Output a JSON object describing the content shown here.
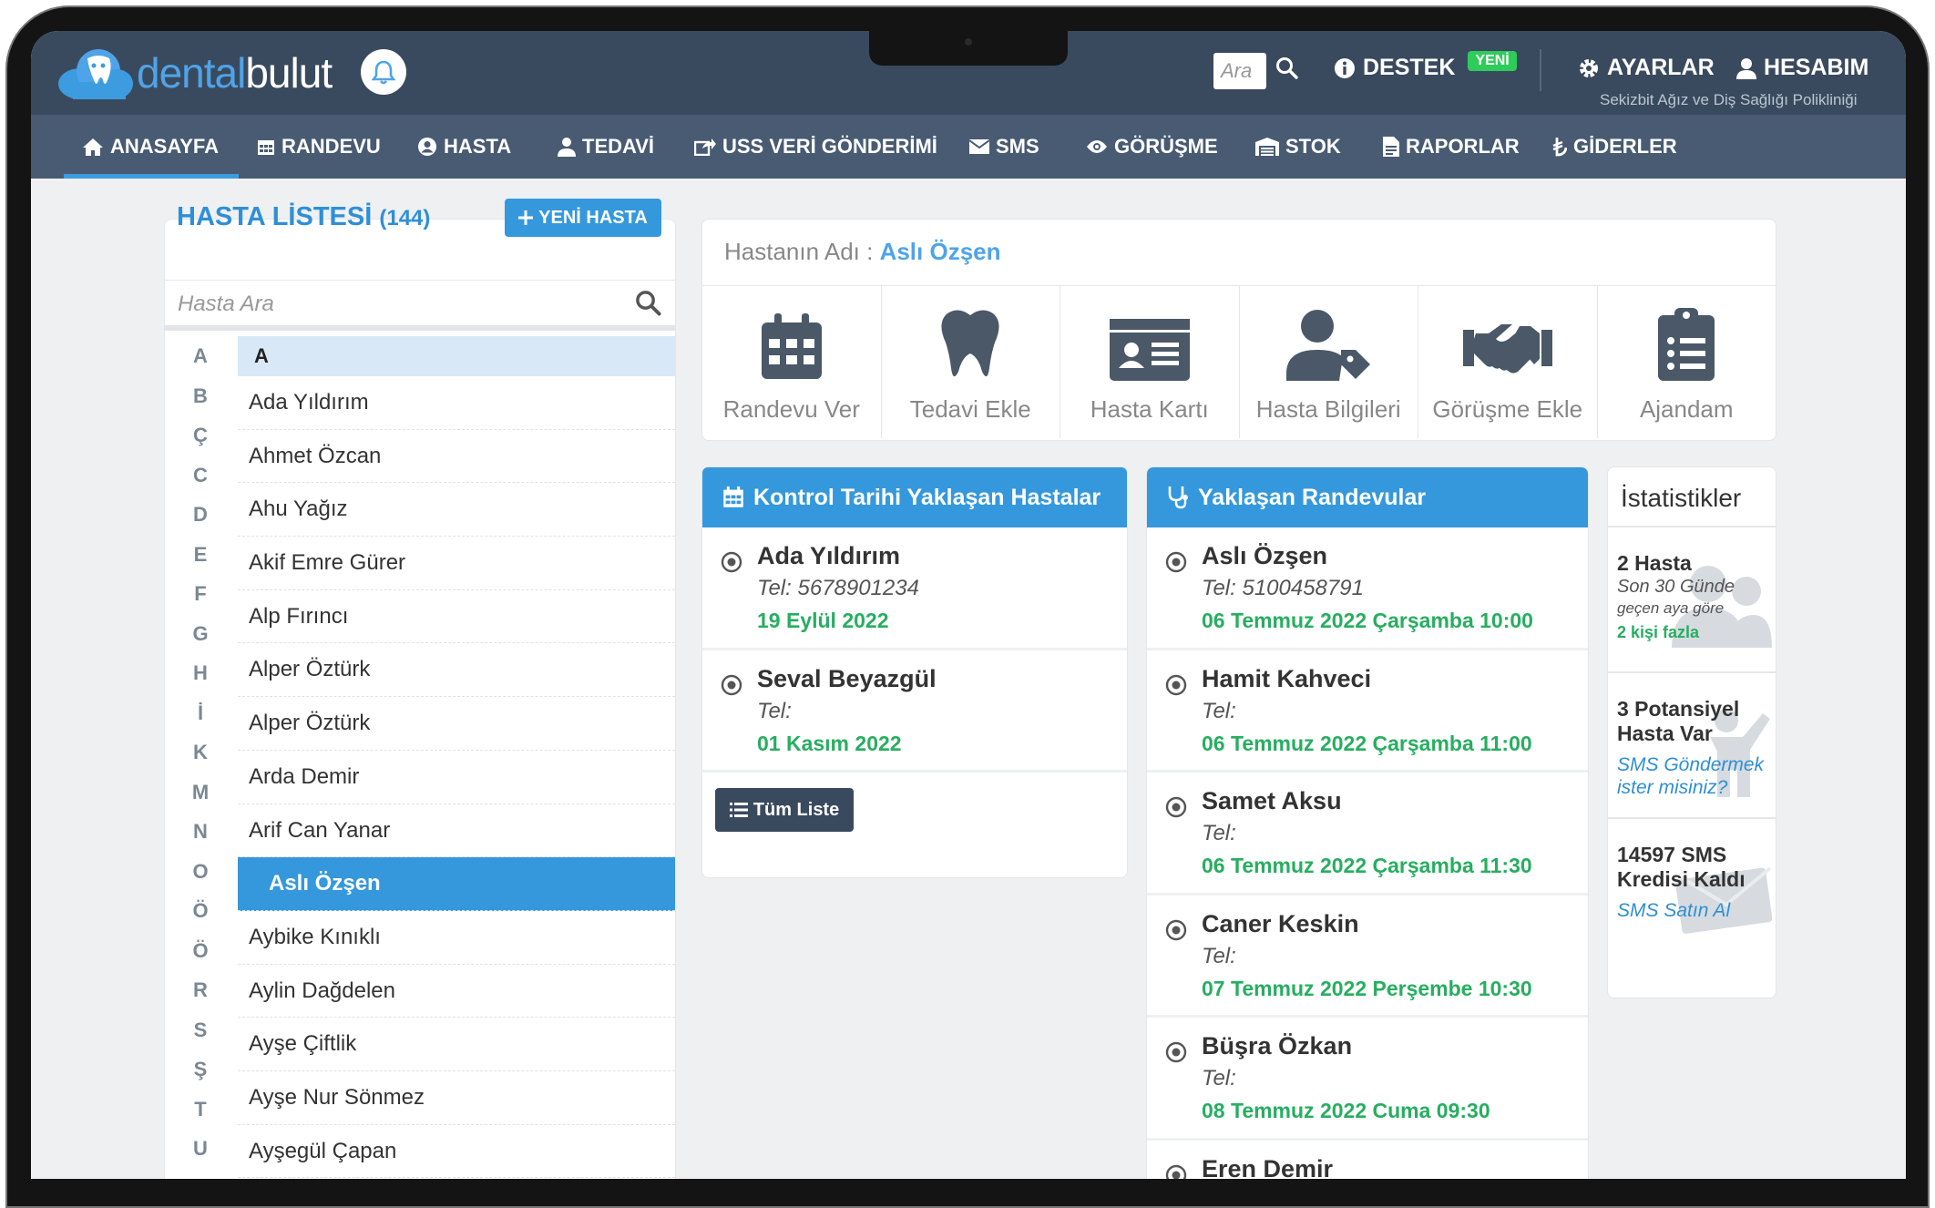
{
  "brand": {
    "part1": "dental",
    "part2": "bulut"
  },
  "header": {
    "search_placeholder": "Ara",
    "support_label": "DESTEK",
    "new_badge": "YENİ",
    "settings_label": "AYARLAR",
    "account_label": "HESABIM",
    "clinic_name": "Sekizbit Ağız ve Diş Sağlığı Polikliniği"
  },
  "nav": [
    {
      "label": "ANASAYFA",
      "icon": "home-icon"
    },
    {
      "label": "RANDEVU",
      "icon": "calendar-icon"
    },
    {
      "label": "HASTA",
      "icon": "user-circle-icon"
    },
    {
      "label": "TEDAVİ",
      "icon": "user-md-icon"
    },
    {
      "label": "USS VERİ GÖNDERİMİ",
      "icon": "share-icon"
    },
    {
      "label": "SMS",
      "icon": "envelope-icon"
    },
    {
      "label": "GÖRÜŞME",
      "icon": "eye-icon"
    },
    {
      "label": "STOK",
      "icon": "warehouse-icon"
    },
    {
      "label": "RAPORLAR",
      "icon": "file-icon"
    },
    {
      "label": "GİDERLER",
      "icon": "lira-icon"
    }
  ],
  "patients": {
    "title": "HASTA LİSTESİ",
    "count": "(144)",
    "new_button": "YENİ HASTA",
    "search_placeholder": "Hasta Ara",
    "letters": [
      "A",
      "B",
      "Ç",
      "C",
      "D",
      "E",
      "F",
      "G",
      "H",
      "İ",
      "K",
      "M",
      "N",
      "O",
      "Ö",
      "Ö",
      "R",
      "S",
      "Ş",
      "T",
      "U"
    ],
    "group_header": "A",
    "items": [
      "Ada Yıldırım",
      "Ahmet Özcan",
      "Ahu Yağız",
      "Akif Emre Gürer",
      "Alp Fırıncı",
      "Alper Öztürk",
      "Alper Öztürk",
      "Arda Demir",
      "Arif Can Yanar",
      "Aslı Özşen",
      "Aybike Kınıklı",
      "Aylin Dağdelen",
      "Ayşe Çiftlik",
      "Ayşe Nur Sönmez",
      "Ayşegül Çapan"
    ],
    "selected_index": 9
  },
  "patient_name": {
    "label": "Hastanın Adı :",
    "value": "Aslı Özşen"
  },
  "actions": [
    {
      "label": "Randevu Ver",
      "icon": "calendar-icon"
    },
    {
      "label": "Tedavi Ekle",
      "icon": "tooth-icon"
    },
    {
      "label": "Hasta Kartı",
      "icon": "id-card-icon"
    },
    {
      "label": "Hasta Bilgileri",
      "icon": "user-tag-icon"
    },
    {
      "label": "Görüşme Ekle",
      "icon": "handshake-icon"
    },
    {
      "label": "Ajandam",
      "icon": "clipboard-list-icon"
    }
  ],
  "control": {
    "title": "Kontrol Tarihi Yaklaşan Hastalar",
    "entries": [
      {
        "name": "Ada Yıldırım",
        "tel": "Tel: 5678901234",
        "date": "19 Eylül 2022"
      },
      {
        "name": "Seval Beyazgül",
        "tel": "Tel:",
        "date": "01 Kasım 2022"
      }
    ],
    "all_button": "Tüm Liste"
  },
  "appointments": {
    "title": "Yaklaşan Randevular",
    "entries": [
      {
        "name": "Aslı Özşen",
        "tel": "Tel: 5100458791",
        "date": "06 Temmuz 2022 Çarşamba 10:00"
      },
      {
        "name": "Hamit Kahveci",
        "tel": "Tel:",
        "date": "06 Temmuz 2022 Çarşamba 11:00"
      },
      {
        "name": "Samet Aksu",
        "tel": "Tel:",
        "date": "06 Temmuz 2022 Çarşamba 11:30"
      },
      {
        "name": "Caner Keskin",
        "tel": "Tel:",
        "date": "07 Temmuz 2022 Perşembe 10:30"
      },
      {
        "name": "Büşra Özkan",
        "tel": "Tel:",
        "date": "08 Temmuz 2022 Cuma 09:30"
      },
      {
        "name": "Eren Demir",
        "tel": "",
        "date": ""
      }
    ]
  },
  "stats": {
    "title": "İstatistikler",
    "items": [
      {
        "line1": "2 Hasta",
        "line2a": "Son 30 Günde",
        "line2b": "geçen aya göre",
        "line3": "2 kişi fazla"
      },
      {
        "line1a": "3 Potansiyel",
        "line1b": "Hasta Var",
        "link_a": "SMS Göndermek",
        "link_b": "ister misiniz?"
      },
      {
        "line1a": "14597 SMS",
        "line1b": "Kredisi Kaldı",
        "link": "SMS Satın Al"
      }
    ]
  },
  "colors": {
    "accent": "#3598dc",
    "topbar": "#3a4a5e",
    "navbar": "#485b72",
    "success": "#27ae60"
  }
}
